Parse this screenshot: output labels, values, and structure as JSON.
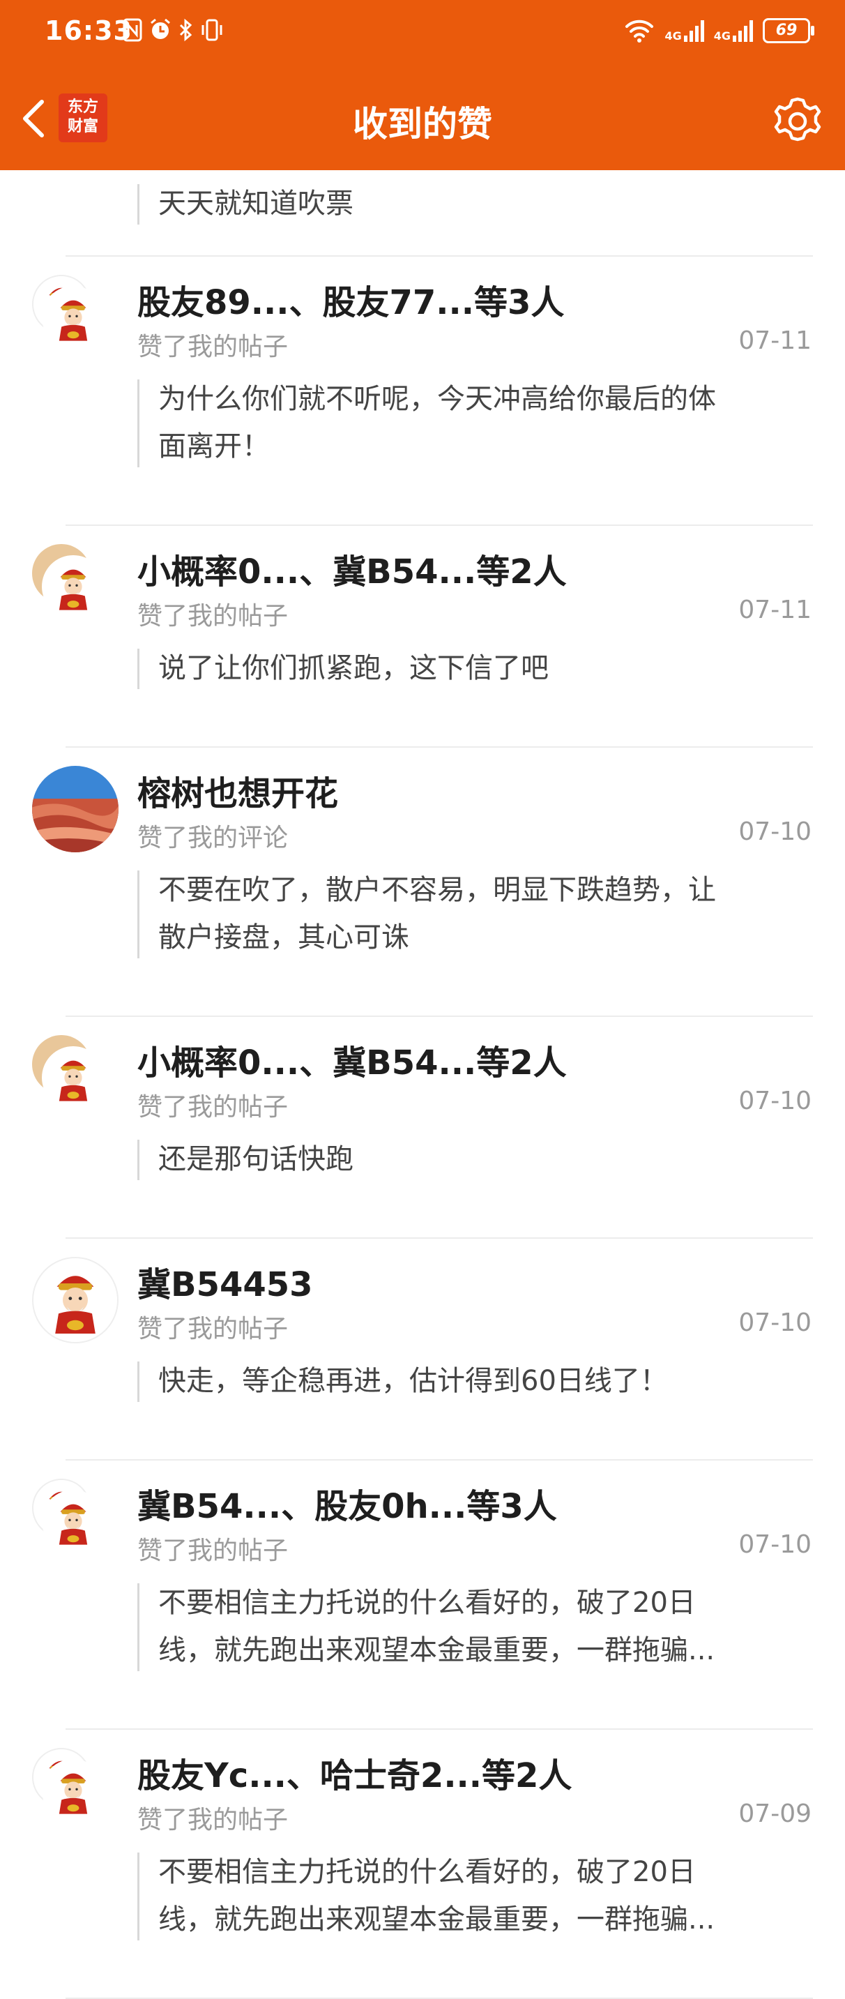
{
  "status": {
    "time": "16:33",
    "battery": "69",
    "net1": "4G",
    "net2": "4G"
  },
  "header": {
    "title": "收到的赞",
    "logo_line1": "东方",
    "logo_line2": "财富"
  },
  "colors": {
    "brand": "#EA5A0C",
    "divider": "#ececec",
    "meta": "#9a9a9a"
  },
  "partial_comment": "天天就知道吹票",
  "items": [
    {
      "names": "股友89...、股友77...等3人",
      "action": "赞了我的帖子",
      "date": "07-11",
      "comment": [
        "为什么你们就不听呢，今天冲高给你最后的体",
        "面离开！"
      ],
      "avatar": "group"
    },
    {
      "names": "小概率0...、冀B54...等2人",
      "action": "赞了我的帖子",
      "date": "07-11",
      "comment": [
        "说了让你们抓紧跑，这下信了吧"
      ],
      "avatar": "group-tan"
    },
    {
      "names": "榕树也想开花",
      "action": "赞了我的评论",
      "date": "07-10",
      "comment": [
        "不要在吹了，散户不容易，明显下跌趋势，让",
        "散户接盘，其心可诛"
      ],
      "avatar": "photo"
    },
    {
      "names": "小概率0...、冀B54...等2人",
      "action": "赞了我的帖子",
      "date": "07-10",
      "comment": [
        "还是那句话快跑"
      ],
      "avatar": "group-tan"
    },
    {
      "names": "冀B54453",
      "action": "赞了我的帖子",
      "date": "07-10",
      "comment": [
        "快走，等企稳再进，估计得到60日线了！"
      ],
      "avatar": "single"
    },
    {
      "names": "冀B54...、股友0h...等3人",
      "action": "赞了我的帖子",
      "date": "07-10",
      "comment": [
        "不要相信主力托说的什么看好的，破了20日",
        "线，就先跑出来观望本金最重要，一群拖骗..."
      ],
      "avatar": "group"
    },
    {
      "names": "股友Yc...、哈士奇2...等2人",
      "action": "赞了我的帖子",
      "date": "07-09",
      "comment": [
        "不要相信主力托说的什么看好的，破了20日",
        "线，就先跑出来观望本金最重要，一群拖骗..."
      ],
      "avatar": "group"
    }
  ]
}
